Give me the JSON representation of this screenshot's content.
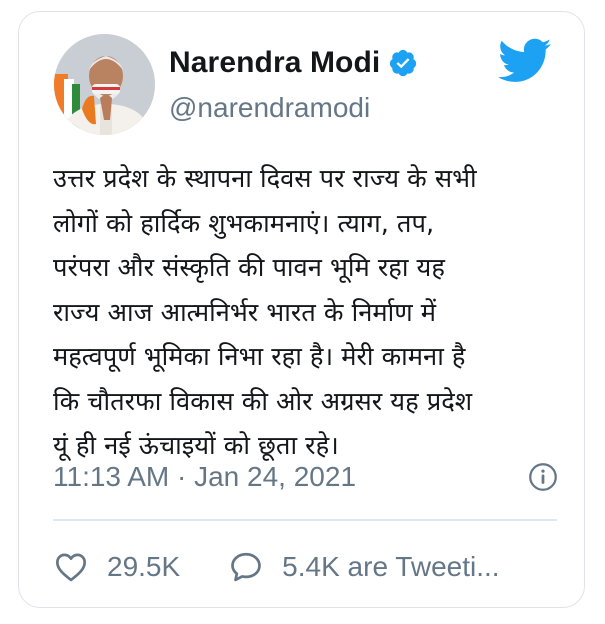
{
  "author": {
    "display_name": "Narendra Modi",
    "handle": "@narendramodi",
    "verified": true,
    "avatar_icon": "profile-photo"
  },
  "brand": {
    "icon": "twitter-bird-icon",
    "color": "#1da1f2"
  },
  "tweet": {
    "lines": [
      "उत्तर प्रदेश के स्थापना दिवस पर राज्य के सभी",
      "लोगों को हार्दिक शुभकामनाएं। त्याग, तप,",
      "परंपरा और संस्कृति की पावन भूमि रहा यह",
      "राज्य आज आत्मनिर्भर भारत के निर्माण में",
      "महत्वपूर्ण भूमिका निभा रहा है। मेरी कामना है",
      "कि चौतरफा विकास की ओर अग्रसर यह प्रदेश",
      "यूं ही नई ऊंचाइयों को छूता रहे।"
    ],
    "timestamp": "11:13 AM · Jan 24, 2021"
  },
  "actions": {
    "like_count": "29.5K",
    "retweet_label": "5.4K are Tweeti..."
  },
  "colors": {
    "text": "#14171a",
    "secondary": "#657786",
    "border": "#dfe3e7",
    "verified_badge": "#1da1f2"
  }
}
